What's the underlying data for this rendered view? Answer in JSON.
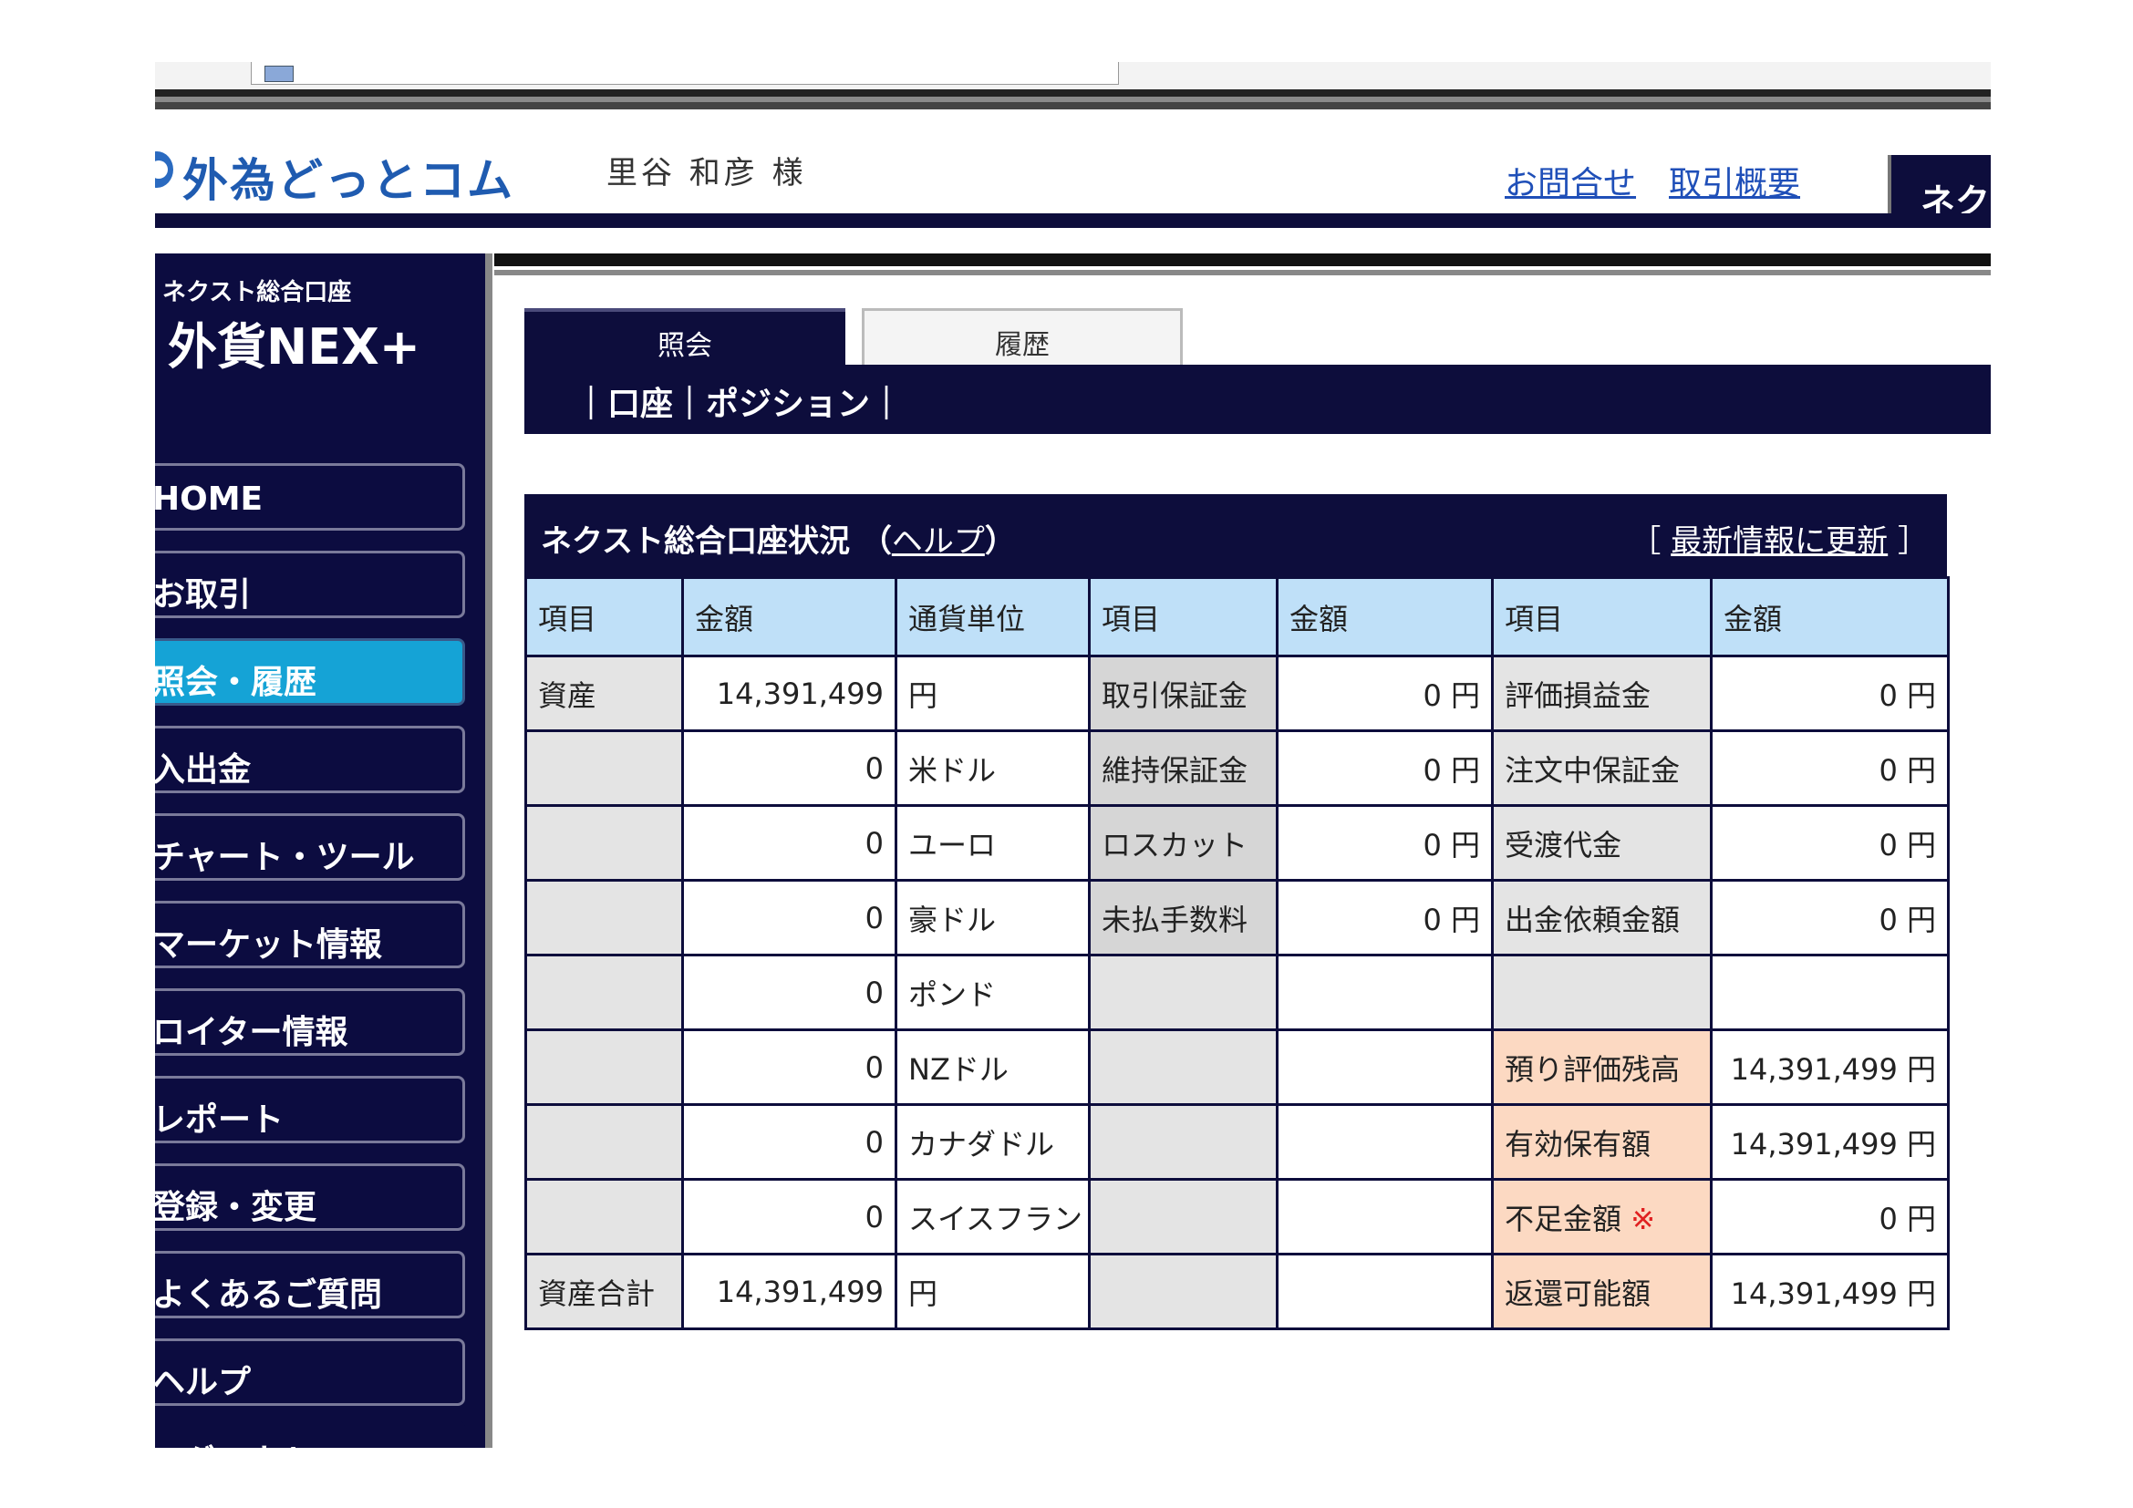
{
  "header": {
    "logo": "外為どっとコム",
    "user_name": "里谷 和彦 様",
    "link_contact": "お問合せ",
    "link_summary": "取引概要",
    "tab_label": "ネクス"
  },
  "sidebar": {
    "brand_sub": "ネクスト総合口座",
    "brand_main": "外貨NEX+",
    "items": [
      {
        "label": "HOME"
      },
      {
        "label": "お取引"
      },
      {
        "label": "照会・履歴"
      },
      {
        "label": "入出金"
      },
      {
        "label": "チャート・ツール"
      },
      {
        "label": "マーケット情報"
      },
      {
        "label": "ロイター情報"
      },
      {
        "label": "レポート"
      },
      {
        "label": "登録・変更"
      },
      {
        "label": "よくあるご質問"
      },
      {
        "label": "ヘルプ"
      },
      {
        "label": "ログアウト"
      }
    ],
    "active_index": 2
  },
  "tabs": [
    {
      "label": "照会"
    },
    {
      "label": "履歴"
    }
  ],
  "subnav": "｜口座｜ポジション｜",
  "panel": {
    "title": "ネクスト総合口座状況",
    "help_open": "（",
    "help": "ヘルプ",
    "help_close": "）",
    "refresh_open": "［",
    "refresh": "最新情報に更新",
    "refresh_close": "］"
  },
  "table": {
    "headers": [
      "項目",
      "金額",
      "通貨単位",
      "項目",
      "金額",
      "項目",
      "金額"
    ],
    "rows": [
      [
        "資産",
        "14,391,499",
        "円",
        "取引保証金",
        "0 円",
        "評価損益金",
        "0 円"
      ],
      [
        "",
        "0",
        "米ドル",
        "維持保証金",
        "0 円",
        "注文中保証金",
        "0 円"
      ],
      [
        "",
        "0",
        "ユーロ",
        "ロスカット",
        "0 円",
        "受渡代金",
        "0 円"
      ],
      [
        "",
        "0",
        "豪ドル",
        "未払手数料",
        "0 円",
        "出金依頼金額",
        "0 円"
      ],
      [
        "",
        "0",
        "ポンド",
        "",
        "",
        "",
        ""
      ],
      [
        "",
        "0",
        "NZドル",
        "",
        "",
        "預り評価残高",
        "14,391,499 円"
      ],
      [
        "",
        "0",
        "カナダドル",
        "",
        "",
        "有効保有額",
        "14,391,499 円"
      ],
      [
        "",
        "0",
        "スイスフラン",
        "",
        "",
        "不足金額",
        "0 円"
      ],
      [
        "資産合計",
        "14,391,499",
        "円",
        "",
        "",
        "返還可能額",
        "14,391,499 円"
      ]
    ],
    "shortage_mark": "※"
  },
  "colors": {
    "navy": "#0d0d3c",
    "active_nav": "#15a3d6",
    "header_row": "#bfe0f8",
    "pink": "#fcd9c2",
    "link": "#1f4fb8"
  }
}
